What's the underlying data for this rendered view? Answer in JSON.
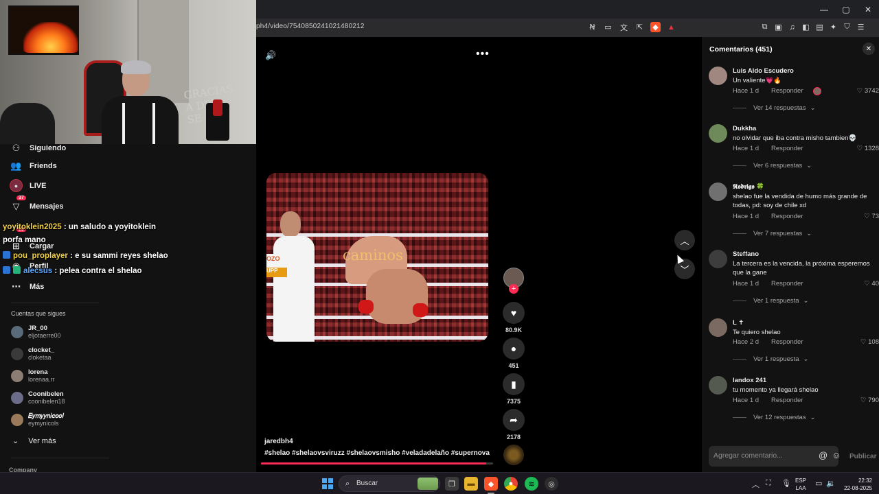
{
  "browser": {
    "url": "ph4/video/7540850241021480212",
    "window_controls": [
      "—",
      "▢",
      "✕"
    ]
  },
  "sidebar": {
    "nav": [
      {
        "label": "Siguiendo",
        "icon": "following-icon"
      },
      {
        "label": "Friends",
        "icon": "friends-icon"
      },
      {
        "label": "LIVE",
        "icon": "live-icon"
      },
      {
        "label": "Mensajes",
        "icon": "messages-icon",
        "badge": "37"
      },
      {
        "label": "Cargar",
        "icon": "upload-icon",
        "badge": "53"
      },
      {
        "label": "Perfil",
        "icon": "profile-icon"
      },
      {
        "label": "Más",
        "icon": "more-icon"
      }
    ],
    "following_title": "Cuentas que sigues",
    "following": [
      {
        "name": "JR_00",
        "handle": "eljotaerre00"
      },
      {
        "name": "clocket_",
        "handle": "cloketaa"
      },
      {
        "name": "lorena",
        "handle": "lorenaa.rr"
      },
      {
        "name": "Coonibelen",
        "handle": "coonibelen18"
      },
      {
        "name": "𝐸𝑦𝑚𝑦𝑦𝑛𝑖𝑐𝑜𝑜𝑙",
        "handle": "eymynicols"
      }
    ],
    "see_more": "Ver más",
    "company": "Company"
  },
  "webcam": {
    "wall_text": "GRACIAS\nA DIOS\nSE"
  },
  "chat": [
    {
      "user": "yoyitoklein2025",
      "message": " : un saludo a yoyitoklein",
      "cont": "porfa mano"
    },
    {
      "user": "pou_proplayer",
      "message": " : e su sammi reyes shelao"
    },
    {
      "user": "alecsus",
      "message": " : pelea contra el shelao"
    }
  ],
  "video": {
    "overlay_text": "caminos",
    "sponsor_1": "OZO",
    "sponsor_2": "UPP",
    "author": "jaredbh4",
    "tags": "#shelao #shelaovsviruzz #shelaovsmisho #veladadelaño #supernova",
    "likes": "80.9K",
    "comments": "451",
    "saves": "7375",
    "shares": "2178",
    "progress": 0.97
  },
  "comments_panel": {
    "title": "Comentarios (451)",
    "input_placeholder": "Agregar comentario...",
    "publish": "Publicar",
    "reply_label": "Responder",
    "items": [
      {
        "user": "Luis Aldo Escudero",
        "text": "Un valiente💗🔥",
        "time": "Hace 1 d",
        "likes": "3742",
        "replies": "Ver 14 respuestas",
        "creator_liked": true
      },
      {
        "user": "Dukkha",
        "text": "no olvidar que iba contra misho tambien💀",
        "time": "Hace 1 d",
        "likes": "1328",
        "replies": "Ver 6 respuestas"
      },
      {
        "user": "𝕽𝖔𝖉𝖗𝖎𝖌𝖔 🍀",
        "text": "shelao fue la vendida de humo más grande de todas, pd: soy de chile xd",
        "time": "Hace 1 d",
        "likes": "73",
        "replies": "Ver 7 respuestas"
      },
      {
        "user": "Steffano",
        "text": "La tercera es la vencida, la próxima esperemos que la gane",
        "time": "Hace 1 d",
        "likes": "40",
        "replies": "Ver 1 respuesta"
      },
      {
        "user": "L ✝",
        "text": "Te quiero shelao",
        "time": "Hace 2 d",
        "likes": "108",
        "replies": "Ver 1 respuesta"
      },
      {
        "user": "landox 241",
        "text": "tu momento ya llegará shelao",
        "time": "Hace 1 d",
        "likes": "790",
        "replies": "Ver 12 respuestas"
      }
    ]
  },
  "taskbar": {
    "search": "Buscar",
    "lang_1": "ESP",
    "lang_2": "LAA",
    "time": "22:32",
    "date": "22-08-2025"
  }
}
